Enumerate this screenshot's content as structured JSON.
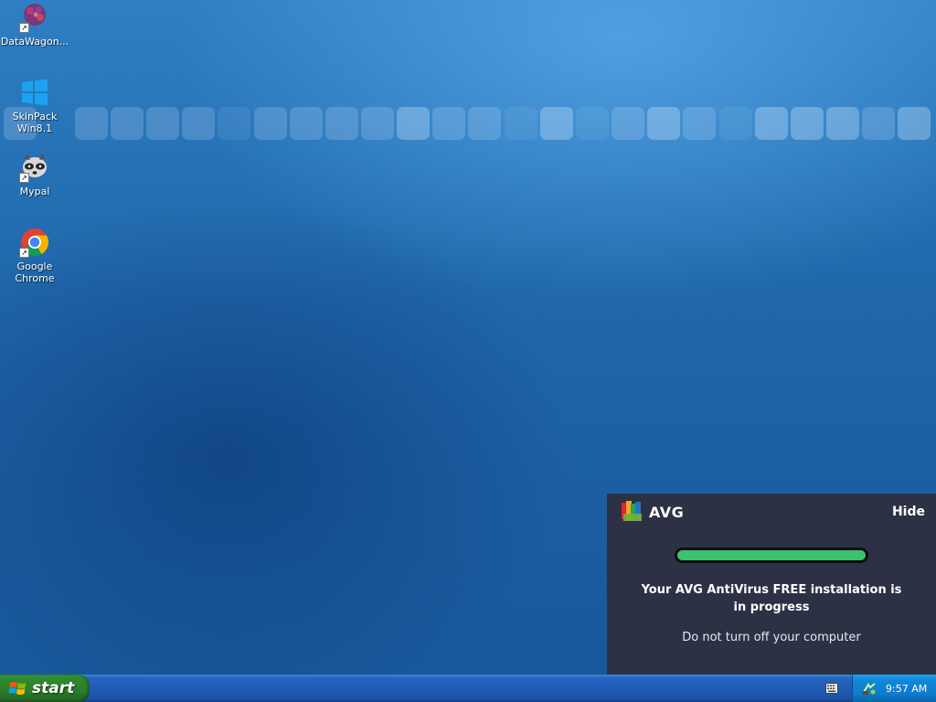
{
  "desktop": {
    "icons": [
      {
        "label": "DataWagon...",
        "icon": "datawagon-icon"
      },
      {
        "label": "SkinPack Win8.1",
        "icon": "windows-logo-icon"
      },
      {
        "label": "Mypal",
        "icon": "raccoon-icon"
      },
      {
        "label": "Google Chrome",
        "icon": "chrome-icon"
      }
    ]
  },
  "avg": {
    "logo": "AVG",
    "hide": "Hide",
    "progress": 1.0,
    "message": "Your AVG AntiVirus FREE installation is in progress",
    "sub": "Do not turn off your computer",
    "progress_color": "#3cc26f"
  },
  "taskbar": {
    "start": "start",
    "time": "9:57 AM"
  }
}
